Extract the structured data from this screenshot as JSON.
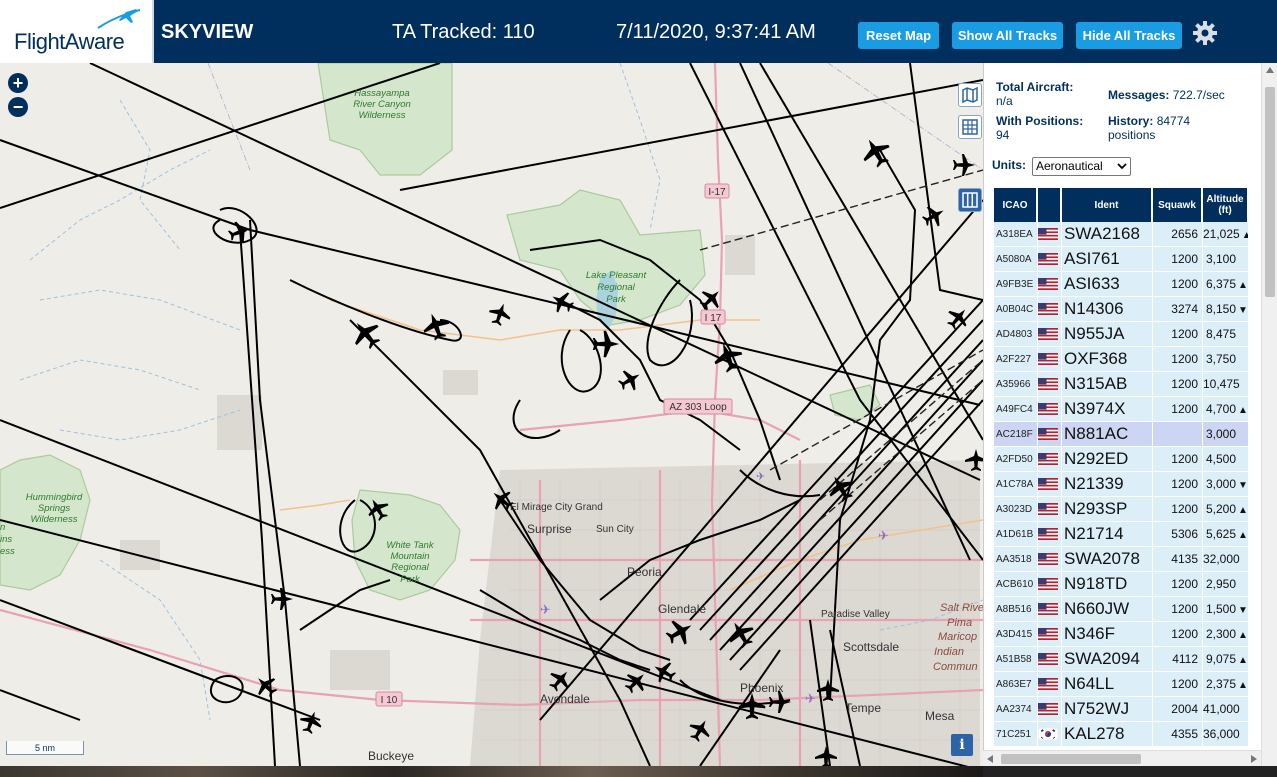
{
  "header": {
    "logo_text": "FlightAware",
    "app_name": "SKYVIEW",
    "tracked": "TA Tracked: 110",
    "datetime": "7/11/2020, 9:37:41 AM",
    "buttons": {
      "reset": "Reset Map",
      "show": "Show All Tracks",
      "hide": "Hide All Tracks"
    },
    "icons": {
      "settings": "gear-icon"
    }
  },
  "map": {
    "zoom_in": "+",
    "zoom_out": "−",
    "scale_label": "5 nm",
    "info": "i",
    "tools": [
      "map-layers-icon",
      "grid-icon",
      "columns-icon"
    ],
    "places": {
      "wilderness_1": [
        "Hassayampa",
        "River Canyon",
        "Wilderness"
      ],
      "lake_pleasant": [
        "Lake Pleasant",
        "Regional",
        "Park"
      ],
      "hummingbird": [
        "Hummingbird",
        "Springs",
        "Wilderness"
      ],
      "white_tank": [
        "White Tank",
        "Mountain",
        "Regional",
        "Park"
      ],
      "city_grand": "El Mirage City Grand",
      "surprise": "Surprise",
      "sun_city": "Sun City",
      "peoria": "Peoria",
      "glendale": "Glendale",
      "paradise_valley": "Paradise Valley",
      "scottsdale": "Scottsdale",
      "phoenix": "Phoenix",
      "avondale": "Avondale",
      "tempe": "Tempe",
      "mesa": "Mesa",
      "buckeye": "Buckeye",
      "salt_river": [
        "Salt Rive",
        "Pima",
        "Maricop",
        "Indian",
        "Commun"
      ],
      "edge_left": [
        "n",
        "ins",
        "ess"
      ],
      "i17_north": "I-17",
      "i17_mid": "I 17",
      "az303": "AZ 303 Loop",
      "i10": "I 10"
    }
  },
  "sidebar": {
    "total_label": "Total Aircraft:",
    "total_value": "n/a",
    "messages_label": "Messages:",
    "messages_value": "722.7/sec",
    "positions_label": "With Positions:",
    "positions_value": "94",
    "history_label": "History:",
    "history_value": "84774",
    "history_unit": "positions",
    "units_label": "Units:",
    "units_value": "Aeronautical",
    "columns": {
      "icao": "ICAO",
      "flag": "",
      "ident": "Ident",
      "squawk": "Squawk",
      "altitude_1": "Altitude",
      "altitude_2": "(ft)"
    },
    "rows": [
      {
        "icao": "A318EA",
        "flag": "us",
        "ident": "SWA2168",
        "squawk": "2656",
        "alt": "21,025",
        "trend": "▲"
      },
      {
        "icao": "A5080A",
        "flag": "us",
        "ident": "ASI761",
        "squawk": "1200",
        "alt": "3,100",
        "trend": ""
      },
      {
        "icao": "A9FB3E",
        "flag": "us",
        "ident": "ASI633",
        "squawk": "1200",
        "alt": "6,375",
        "trend": "▲"
      },
      {
        "icao": "A0B04C",
        "flag": "us",
        "ident": "N14306",
        "squawk": "3274",
        "alt": "8,150",
        "trend": "▼"
      },
      {
        "icao": "AD4803",
        "flag": "us",
        "ident": "N955JA",
        "squawk": "1200",
        "alt": "8,475",
        "trend": ""
      },
      {
        "icao": "A2F227",
        "flag": "us",
        "ident": "OXF368",
        "squawk": "1200",
        "alt": "3,750",
        "trend": ""
      },
      {
        "icao": "A35966",
        "flag": "us",
        "ident": "N315AB",
        "squawk": "1200",
        "alt": "10,475",
        "trend": ""
      },
      {
        "icao": "A49FC4",
        "flag": "us",
        "ident": "N3974X",
        "squawk": "1200",
        "alt": "4,700",
        "trend": "▲"
      },
      {
        "icao": "AC218F",
        "flag": "us",
        "ident": "N881AC",
        "squawk": "",
        "alt": "3,000",
        "trend": "",
        "selected": true
      },
      {
        "icao": "A2FD50",
        "flag": "us",
        "ident": "N292ED",
        "squawk": "1200",
        "alt": "4,500",
        "trend": ""
      },
      {
        "icao": "A1C78A",
        "flag": "us",
        "ident": "N21339",
        "squawk": "1200",
        "alt": "3,000",
        "trend": "▼"
      },
      {
        "icao": "A3023D",
        "flag": "us",
        "ident": "N293SP",
        "squawk": "1200",
        "alt": "5,200",
        "trend": "▲"
      },
      {
        "icao": "A1D61B",
        "flag": "us",
        "ident": "N21714",
        "squawk": "5306",
        "alt": "5,625",
        "trend": "▲"
      },
      {
        "icao": "AA3518",
        "flag": "us",
        "ident": "SWA2078",
        "squawk": "4135",
        "alt": "32,000",
        "trend": ""
      },
      {
        "icao": "ACB610",
        "flag": "us",
        "ident": "N918TD",
        "squawk": "1200",
        "alt": "2,950",
        "trend": ""
      },
      {
        "icao": "A8B516",
        "flag": "us",
        "ident": "N660JW",
        "squawk": "1200",
        "alt": "1,500",
        "trend": "▼"
      },
      {
        "icao": "A3D415",
        "flag": "us",
        "ident": "N346F",
        "squawk": "1200",
        "alt": "2,300",
        "trend": "▲"
      },
      {
        "icao": "A51B58",
        "flag": "us",
        "ident": "SWA2094",
        "squawk": "4112",
        "alt": "9,075",
        "trend": "▲"
      },
      {
        "icao": "A863E7",
        "flag": "us",
        "ident": "N64LL",
        "squawk": "1200",
        "alt": "2,375",
        "trend": "▲"
      },
      {
        "icao": "AA2374",
        "flag": "us",
        "ident": "N752WJ",
        "squawk": "2004",
        "alt": "41,000",
        "trend": ""
      },
      {
        "icao": "71C251",
        "flag": "kr",
        "ident": "KAL278",
        "squawk": "4355",
        "alt": "36,000",
        "trend": ""
      }
    ]
  },
  "colors": {
    "header_bg": "#002F5D",
    "button_bg": "#1A9CE3",
    "row_bg": "#DCEEF8",
    "row_selected": "#CCD6F2",
    "map_bg": "#EFEDE8"
  }
}
